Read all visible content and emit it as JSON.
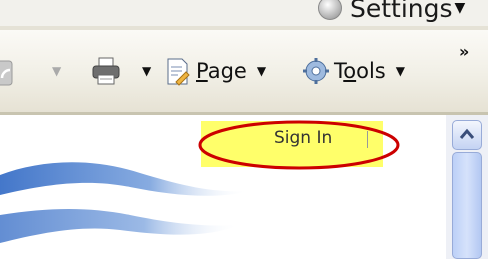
{
  "settings": {
    "label": "Settings",
    "icon": "settings-circle-icon"
  },
  "toolbar": {
    "page_prefix": "",
    "page_underlined": "P",
    "page_rest": "age",
    "tools_prefix": "T",
    "tools_underlined": "o",
    "tools_rest": "ols",
    "overflow": "»",
    "icons": [
      "rss-feed-icon",
      "print-icon",
      "page-icon",
      "gear-icon"
    ]
  },
  "content": {
    "sign_in": "Sign In"
  },
  "colors": {
    "highlight": "#ffff6a",
    "annotation_ring": "#cc0000",
    "scroll_blue": "#bcd0f7"
  }
}
